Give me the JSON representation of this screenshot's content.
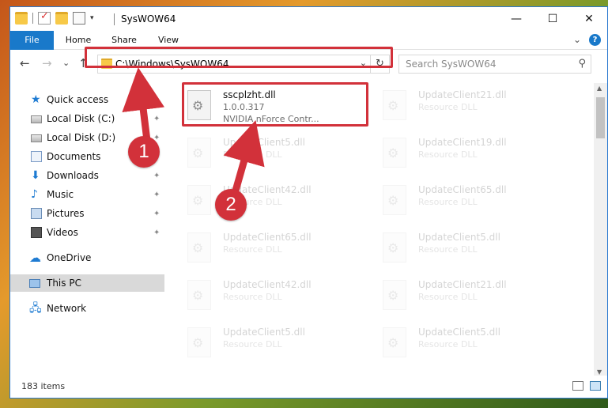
{
  "window": {
    "title": "SysWOW64"
  },
  "titlebar": {
    "minimize": "—",
    "maximize": "☐",
    "close": "✕",
    "qat_dropdown": "▾"
  },
  "ribbon": {
    "tabs": [
      "File",
      "Home",
      "Share",
      "View"
    ],
    "collapse_glyph": "⌄",
    "help_glyph": "?"
  },
  "navbar": {
    "back": "←",
    "forward": "→",
    "recent": "⌄",
    "up": "↑",
    "address": "C:\\Windows\\SysWOW64",
    "address_dropdown": "⌄",
    "refresh": "↻",
    "search_placeholder": "Search SysWOW64",
    "search_glyph": "⚲"
  },
  "sidebar": {
    "items": [
      {
        "label": "Quick access",
        "icon": "star-icon",
        "pinned": false
      },
      {
        "label": "Local Disk (C:)",
        "icon": "disk-icon",
        "pinned": true
      },
      {
        "label": "Local Disk (D:)",
        "icon": "disk-icon",
        "pinned": true
      },
      {
        "label": "Documents",
        "icon": "documents-icon",
        "pinned": true
      },
      {
        "label": "Downloads",
        "icon": "downloads-icon",
        "pinned": true
      },
      {
        "label": "Music",
        "icon": "music-icon",
        "pinned": true
      },
      {
        "label": "Pictures",
        "icon": "pictures-icon",
        "pinned": true
      },
      {
        "label": "Videos",
        "icon": "videos-icon",
        "pinned": true
      },
      {
        "label": "OneDrive",
        "icon": "cloud-icon",
        "pinned": false
      },
      {
        "label": "This PC",
        "icon": "pc-icon",
        "pinned": false,
        "selected": true
      },
      {
        "label": "Network",
        "icon": "network-icon",
        "pinned": false
      }
    ],
    "pin_glyph": "📌"
  },
  "files": {
    "highlighted": {
      "name": "sscplzht.dll",
      "version": "1.0.0.317",
      "description": "NVIDIA nForce Contr..."
    },
    "left_column": [
      {
        "name": "UpdateClient5.dll",
        "type": "Resource DLL"
      },
      {
        "name": "UpdateClient42.dll",
        "type": "Resource DLL"
      },
      {
        "name": "UpdateClient65.dll",
        "type": "Resource DLL"
      },
      {
        "name": "UpdateClient42.dll",
        "type": "Resource DLL"
      },
      {
        "name": "UpdateClient5.dll",
        "type": "Resource DLL"
      }
    ],
    "right_column": [
      {
        "name": "UpdateClient21.dll",
        "type": "Resource DLL"
      },
      {
        "name": "UpdateClient19.dll",
        "type": "Resource DLL"
      },
      {
        "name": "UpdateClient65.dll",
        "type": "Resource DLL"
      },
      {
        "name": "UpdateClient5.dll",
        "type": "Resource DLL"
      },
      {
        "name": "UpdateClient21.dll",
        "type": "Resource DLL"
      },
      {
        "name": "UpdateClient5.dll",
        "type": "Resource DLL"
      }
    ]
  },
  "status": {
    "item_count": "183 items"
  },
  "callouts": [
    "1",
    "2"
  ],
  "colors": {
    "accent": "#1979ca",
    "highlight_red": "#d2313a"
  }
}
